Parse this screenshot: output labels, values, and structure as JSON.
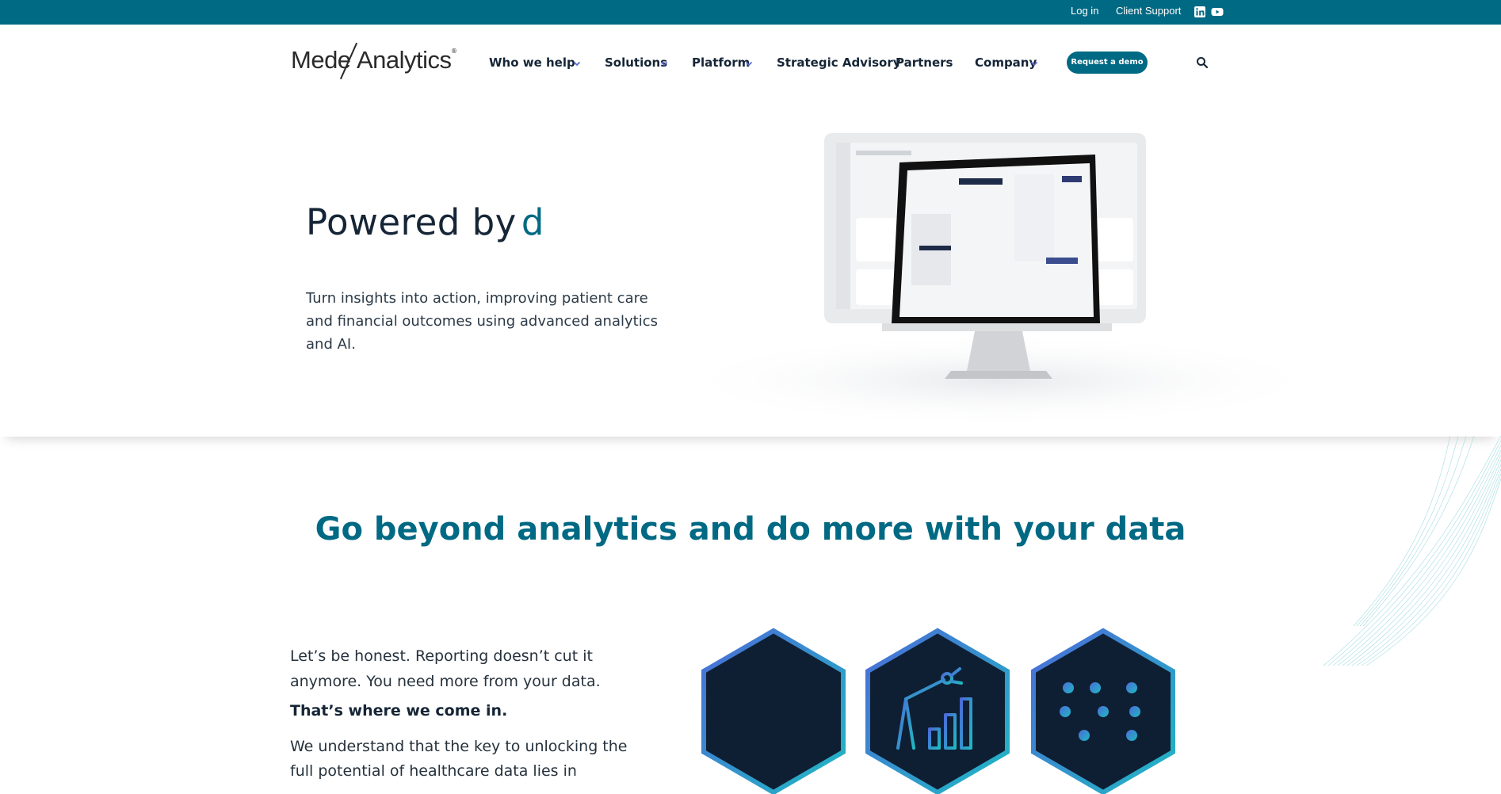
{
  "topbar": {
    "login": "Log in",
    "client_support": "Client Support",
    "icons": [
      "linkedin-icon",
      "youtube-icon"
    ]
  },
  "brand": {
    "logo_left": "Mede",
    "logo_right": "Analytics",
    "logo_reg": "®"
  },
  "nav": {
    "items": [
      {
        "label": "Who we help",
        "has_dropdown": true
      },
      {
        "label": "Solutions",
        "has_dropdown": true
      },
      {
        "label": "Platform",
        "has_dropdown": true
      },
      {
        "label": "Strategic Advisory",
        "has_dropdown": false
      },
      {
        "label": "Partners",
        "has_dropdown": false
      },
      {
        "label": "Company",
        "has_dropdown": true
      }
    ],
    "cta": "Request a demo"
  },
  "hero": {
    "title": "Powered by",
    "title_accent": "d",
    "subtitle": "Turn insights into action, improving patient care and financial outcomes using advanced analytics and AI."
  },
  "section": {
    "title": "Go beyond analytics and do more with your data",
    "para1": "Let’s be honest. Reporting doesn’t cut it anymore. You need more from your data.",
    "para2": "That’s where we come in.",
    "para3": "We understand that the key to unlocking the full potential of healthcare data lies in"
  },
  "colors": {
    "brand": "#006983",
    "navy": "#152536",
    "hex_fill": "#0f1f33",
    "hex_border_start": "#4b6cd8",
    "hex_border_end": "#1fb8c3"
  }
}
